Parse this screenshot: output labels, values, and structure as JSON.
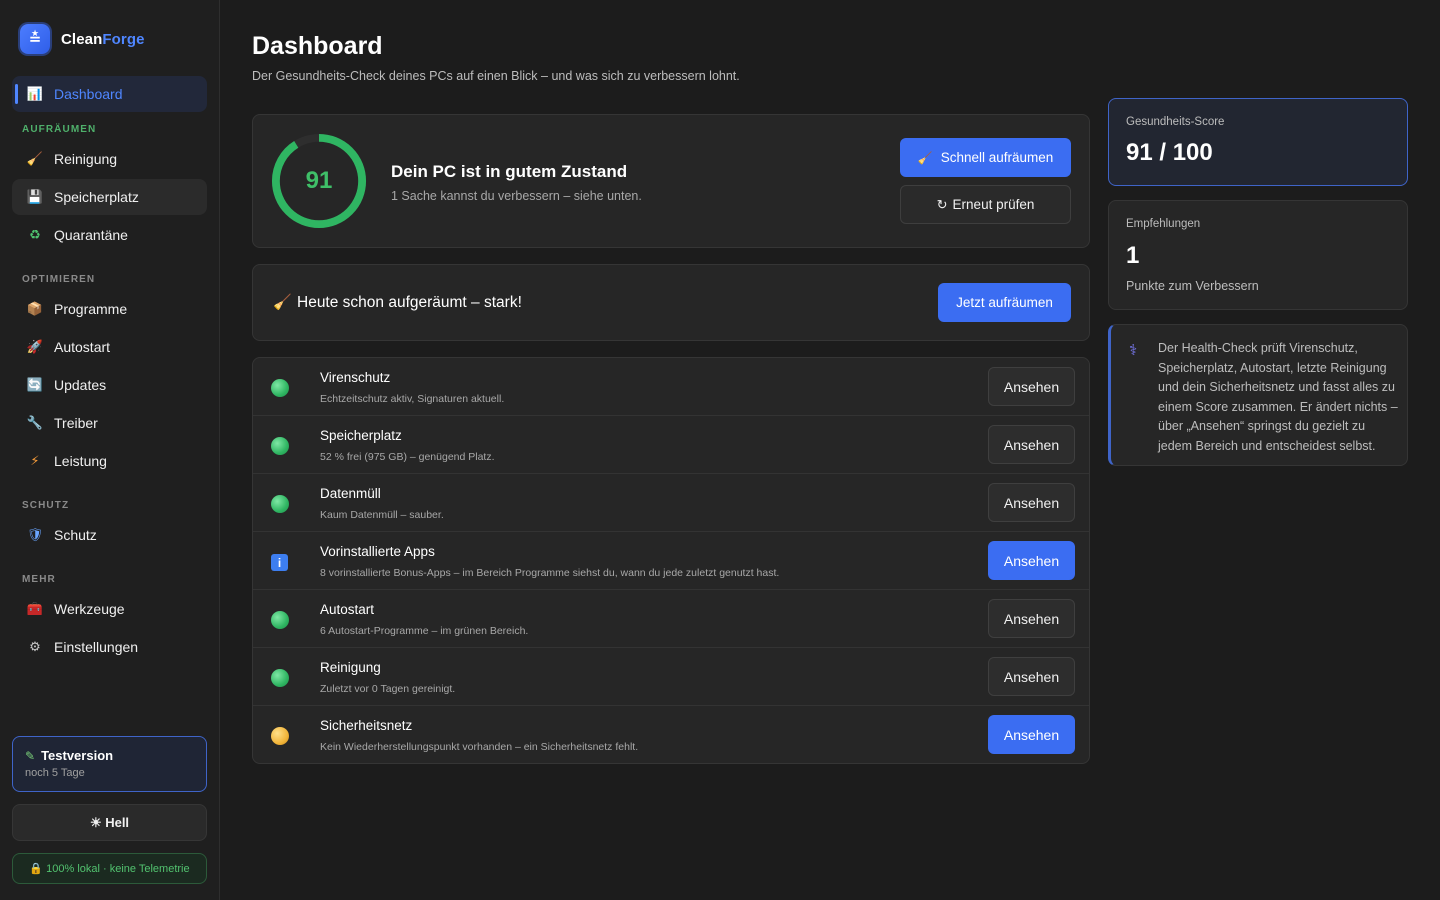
{
  "brand": {
    "name_part1": "Clean",
    "name_part2": "Forge",
    "logo_icon": "≛"
  },
  "sidebar": {
    "dashboard": {
      "label": "Dashboard",
      "icon": "📊"
    },
    "sections": {
      "aufraeumen": "AUFRÄUMEN",
      "optimieren": "OPTIMIEREN",
      "schutz": "SCHUTZ",
      "mehr": "MEHR"
    },
    "items": {
      "reinigung": {
        "label": "Reinigung",
        "icon": "🧹"
      },
      "speicherplatz": {
        "label": "Speicherplatz",
        "icon": "💾"
      },
      "quarantaene": {
        "label": "Quarantäne",
        "icon": "♻"
      },
      "programme": {
        "label": "Programme",
        "icon": "📦"
      },
      "autostart": {
        "label": "Autostart",
        "icon": "🚀"
      },
      "updates": {
        "label": "Updates",
        "icon": "🔄"
      },
      "treiber": {
        "label": "Treiber",
        "icon": "🔧"
      },
      "leistung": {
        "label": "Leistung",
        "icon": "⚡"
      },
      "schutz": {
        "label": "Schutz",
        "icon": "🛡"
      },
      "werkzeuge": {
        "label": "Werkzeuge",
        "icon": "🧰"
      },
      "einstellungen": {
        "label": "Einstellungen",
        "icon": "⚙"
      }
    },
    "trial": {
      "title": "Testversion",
      "subtitle": "noch 5 Tage",
      "icon": "✎"
    },
    "theme_button": "☀ Hell",
    "privacy": "🔒 100% lokal · keine Telemetrie"
  },
  "header": {
    "title": "Dashboard",
    "subtitle": "Der Gesundheits-Check deines PCs auf einen Blick – und was sich zu verbessern lohnt."
  },
  "health": {
    "score": 91,
    "score_max": 100,
    "title": "Dein PC ist in gutem Zustand",
    "subtitle": "1 Sache kannst du verbessern – siehe unten.",
    "quick_clean_label": "Schnell aufräumen",
    "quick_clean_icon": "🧹",
    "recheck_label": "Erneut prüfen",
    "recheck_icon": "↻"
  },
  "clean_banner": {
    "text": "Heute schon aufgeräumt – stark!",
    "icon": "🧹",
    "button": "Jetzt aufräumen"
  },
  "checks": [
    {
      "title": "Virenschutz",
      "desc": "Echtzeitschutz aktiv, Signaturen aktuell.",
      "status": "green",
      "button": "Ansehen",
      "highlight": false
    },
    {
      "title": "Speicherplatz",
      "desc": "52 % frei (975 GB) – genügend Platz.",
      "status": "green",
      "button": "Ansehen",
      "highlight": false
    },
    {
      "title": "Datenmüll",
      "desc": "Kaum Datenmüll – sauber.",
      "status": "green",
      "button": "Ansehen",
      "highlight": false
    },
    {
      "title": "Vorinstallierte Apps",
      "desc": "8 vorinstallierte Bonus-Apps – im Bereich Programme siehst du, wann du jede zuletzt genutzt hast.",
      "status": "info",
      "status_glyph": "i",
      "button": "Ansehen",
      "highlight": true
    },
    {
      "title": "Autostart",
      "desc": "6 Autostart-Programme – im grünen Bereich.",
      "status": "green",
      "button": "Ansehen",
      "highlight": false
    },
    {
      "title": "Reinigung",
      "desc": "Zuletzt vor 0 Tagen gereinigt.",
      "status": "green",
      "button": "Ansehen",
      "highlight": false
    },
    {
      "title": "Sicherheitsnetz",
      "desc": "Kein Wiederherstellungspunkt vorhanden – ein Sicherheitsnetz fehlt.",
      "status": "yellow",
      "button": "Ansehen",
      "highlight": true
    }
  ],
  "stats": {
    "score_label": "Gesundheits-Score",
    "score_value": "91 / 100",
    "reco_label": "Empfehlungen",
    "reco_value": "1",
    "reco_note": "Punkte zum Verbessern"
  },
  "info": {
    "icon": "⚕",
    "text": "Der Health-Check prüft Virenschutz, Speicherplatz, Autostart, letzte Reinigung und dein Sicherheitsnetz und fasst alles zu einem Score zusammen. Er ändert nichts – über „Ansehen“ springst du gezielt zu jedem Bereich und entscheidest selbst."
  },
  "colors": {
    "accent": "#3b6df2",
    "ok": "#2fb562",
    "warn": "#f2b53a",
    "ring_track": "#2e2e2e"
  }
}
